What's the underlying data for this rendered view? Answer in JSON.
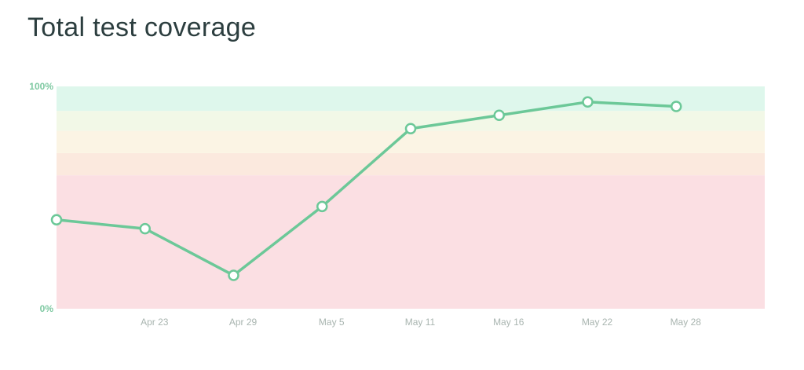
{
  "chart_data": {
    "type": "line",
    "title": "Total test coverage",
    "xlabel": "",
    "ylabel": "",
    "ylim": [
      0,
      100
    ],
    "y_tick_labels": [
      "100%",
      "0%"
    ],
    "x_tick_labels": [
      "Apr 23",
      "Apr 29",
      "May 5",
      "May 11",
      "May 16",
      "May 22",
      "May 28"
    ],
    "x_tick_positions": [
      1.0,
      2.0,
      3.0,
      4.0,
      5.0,
      6.0,
      7.0
    ],
    "x": [
      0.0,
      1.0,
      2.0,
      3.0,
      4.0,
      5.0,
      6.0,
      7.0
    ],
    "values": [
      40,
      36,
      15,
      46,
      81,
      87,
      93,
      91
    ],
    "x_range": [
      0.0,
      8.0
    ],
    "bands": [
      {
        "from": 0,
        "to": 60,
        "color": "#fbdfe3"
      },
      {
        "from": 60,
        "to": 70,
        "color": "#fbe9de"
      },
      {
        "from": 70,
        "to": 80,
        "color": "#fbf4e4"
      },
      {
        "from": 80,
        "to": 89,
        "color": "#f2f8e7"
      },
      {
        "from": 89,
        "to": 100,
        "color": "#def7ec"
      }
    ],
    "line_color": "#6cc898",
    "legend": "none",
    "grid": false
  }
}
